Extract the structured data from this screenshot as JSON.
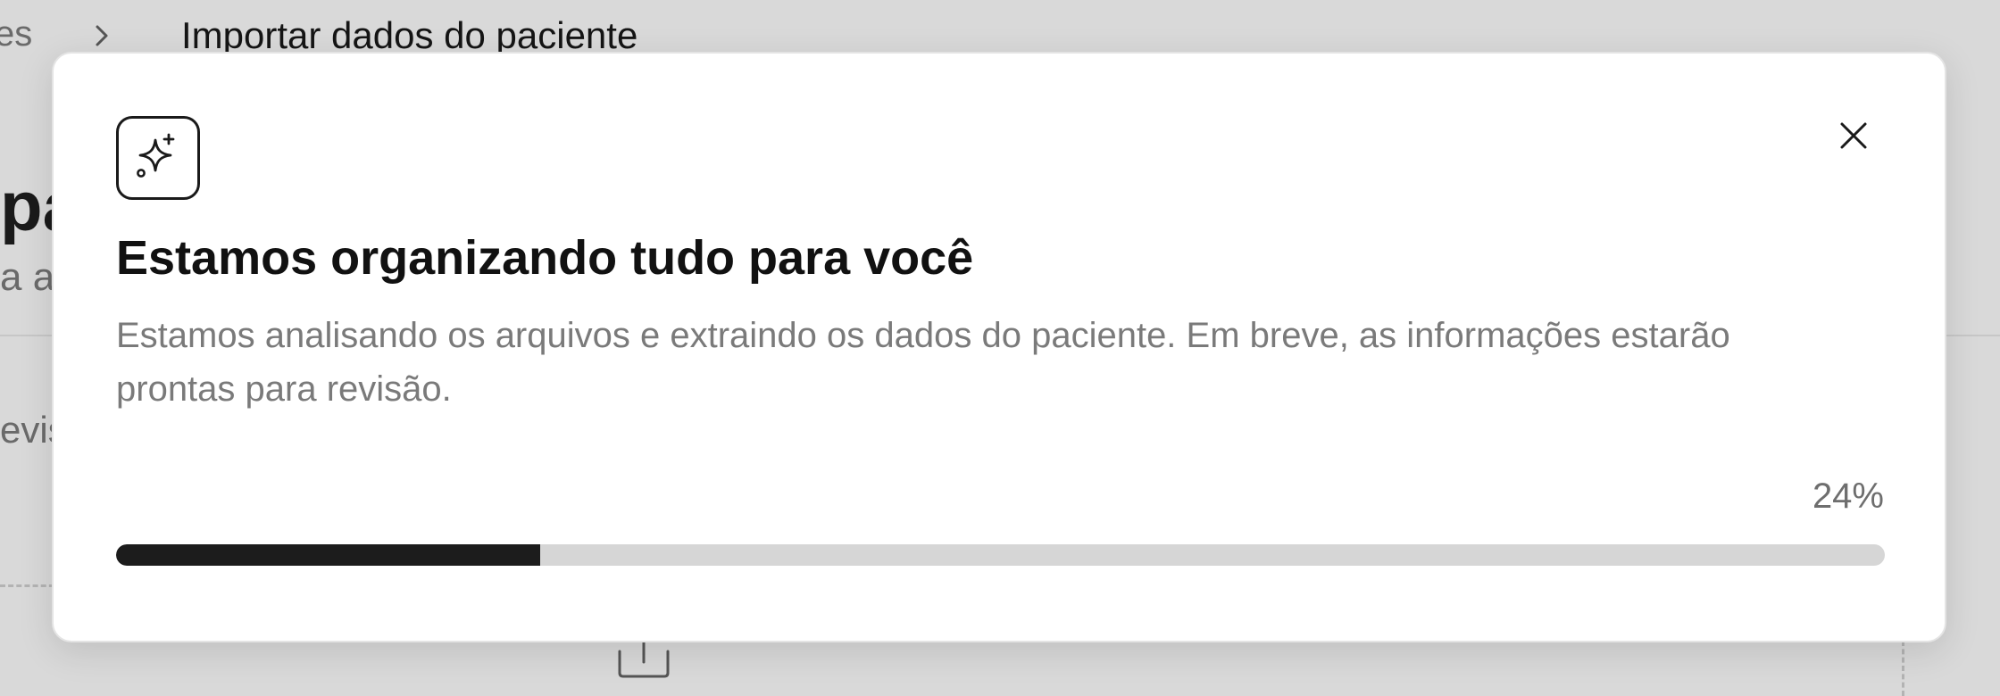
{
  "background": {
    "breadcrumb": {
      "previous_fragment": "es",
      "current": "Importar dados do paciente"
    },
    "page_title_fragment": "pa",
    "page_subtitle_fragment": "a a",
    "section_label_fragment": "evis"
  },
  "modal": {
    "icon": "sparkles-icon",
    "title": "Estamos organizando tudo para você",
    "description": "Estamos analisando os arquivos e extraindo os dados do paciente. Em breve, as informações estarão prontas para revisão.",
    "close_icon": "close-icon",
    "progress": {
      "percent": 24,
      "label": "24%"
    }
  },
  "colors": {
    "overlay": "#d9d9d9",
    "progress_fill": "#1c1c1c",
    "progress_track": "#d6d6d6",
    "muted_text": "#7a7a7a"
  }
}
